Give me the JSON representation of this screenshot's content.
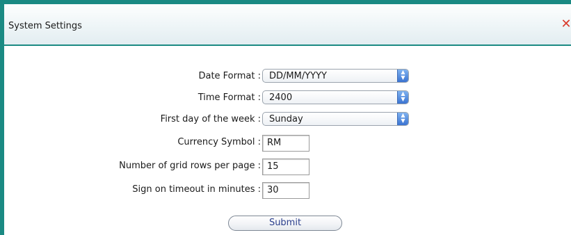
{
  "window": {
    "title": "System Settings",
    "close_icon": "close-icon"
  },
  "form": {
    "date_format": {
      "label": "Date Format :",
      "value": "DD/MM/YYYY"
    },
    "time_format": {
      "label": "Time Format :",
      "value": "2400"
    },
    "first_day": {
      "label": "First day of the week :",
      "value": "Sunday"
    },
    "currency_symbol": {
      "label": "Currency Symbol :",
      "value": "RM"
    },
    "grid_rows": {
      "label": "Number of grid rows per page :",
      "value": "15"
    },
    "timeout": {
      "label": "Sign on timeout in minutes :",
      "value": "30"
    },
    "submit_label": "Submit"
  },
  "colors": {
    "accent": "#1b8a83",
    "close": "#d93a2b",
    "select_arrow": "#3a73d1",
    "submit_text": "#2b3f8c"
  }
}
